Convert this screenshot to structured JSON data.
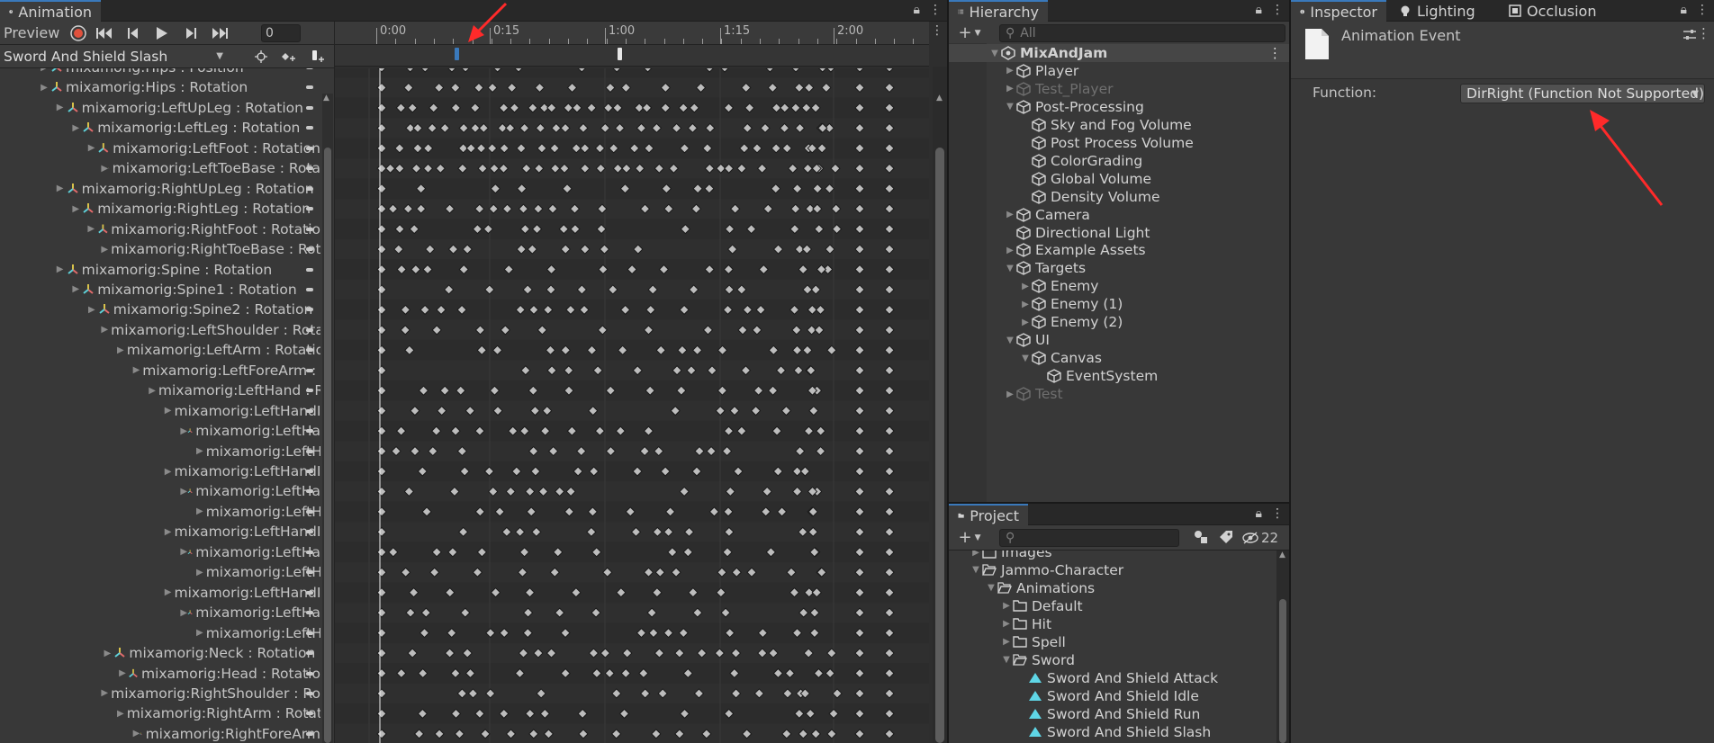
{
  "animation": {
    "tab_title": "Animation",
    "preview_label": "Preview",
    "frame_value": "0",
    "clip_name": "Sword And Shield Slash",
    "ruler_labels": [
      "0:00",
      "0:15",
      "1:00",
      "1:15",
      "2:00"
    ],
    "properties": [
      {
        "label": "mixamorig:Hips : Position",
        "indent": 0,
        "expanded": false
      },
      {
        "label": "mixamorig:Hips : Rotation",
        "indent": 0,
        "expanded": false
      },
      {
        "label": "mixamorig:LeftUpLeg : Rotation",
        "indent": 1,
        "expanded": false
      },
      {
        "label": "mixamorig:LeftLeg : Rotation",
        "indent": 2,
        "expanded": false
      },
      {
        "label": "mixamorig:LeftFoot : Rotation",
        "indent": 3,
        "expanded": false
      },
      {
        "label": "mixamorig:LeftToeBase : Rota",
        "indent": 4,
        "expanded": false
      },
      {
        "label": "mixamorig:RightUpLeg : Rotation",
        "indent": 1,
        "expanded": false
      },
      {
        "label": "mixamorig:RightLeg : Rotation",
        "indent": 2,
        "expanded": false
      },
      {
        "label": "mixamorig:RightFoot : Rotatio",
        "indent": 3,
        "expanded": false
      },
      {
        "label": "mixamorig:RightToeBase : Rot",
        "indent": 4,
        "expanded": false
      },
      {
        "label": "mixamorig:Spine : Rotation",
        "indent": 1,
        "expanded": false
      },
      {
        "label": "mixamorig:Spine1 : Rotation",
        "indent": 2,
        "expanded": false
      },
      {
        "label": "mixamorig:Spine2 : Rotation",
        "indent": 3,
        "expanded": false
      },
      {
        "label": "mixamorig:LeftShoulder : Rota",
        "indent": 4,
        "expanded": false
      },
      {
        "label": "mixamorig:LeftArm : Rotatio",
        "indent": 5,
        "expanded": false
      },
      {
        "label": "mixamorig:LeftForeArm : R",
        "indent": 6,
        "expanded": false
      },
      {
        "label": "mixamorig:LeftHand : R",
        "indent": 7,
        "expanded": false
      },
      {
        "label": "mixamorig:LeftHandI",
        "indent": 8,
        "expanded": false
      },
      {
        "label": "mixamorig:LeftHa",
        "indent": 9,
        "expanded": false
      },
      {
        "label": "mixamorig:LeftH",
        "indent": 10,
        "expanded": false
      },
      {
        "label": "mixamorig:LeftHandI",
        "indent": 8,
        "expanded": false
      },
      {
        "label": "mixamorig:LeftHa",
        "indent": 9,
        "expanded": false
      },
      {
        "label": "mixamorig:LeftH",
        "indent": 10,
        "expanded": false
      },
      {
        "label": "mixamorig:LeftHandI",
        "indent": 8,
        "expanded": false
      },
      {
        "label": "mixamorig:LeftHa",
        "indent": 9,
        "expanded": false
      },
      {
        "label": "mixamorig:LeftH",
        "indent": 10,
        "expanded": false
      },
      {
        "label": "mixamorig:LeftHandI",
        "indent": 8,
        "expanded": false
      },
      {
        "label": "mixamorig:LeftHa",
        "indent": 9,
        "expanded": false
      },
      {
        "label": "mixamorig:LeftH",
        "indent": 10,
        "expanded": false
      },
      {
        "label": "mixamorig:Neck : Rotation",
        "indent": 4,
        "expanded": false
      },
      {
        "label": "mixamorig:Head : Rotatio",
        "indent": 5,
        "expanded": false
      },
      {
        "label": "mixamorig:RightShoulder : Rot",
        "indent": 4,
        "expanded": false
      },
      {
        "label": "mixamorig:RightArm : Rotati",
        "indent": 5,
        "expanded": false
      },
      {
        "label": "mixamorig:RightForeArm",
        "indent": 6,
        "expanded": false
      }
    ]
  },
  "hierarchy": {
    "tab_title": "Hierarchy",
    "search_placeholder": "All",
    "items": [
      {
        "label": "MixAndJam",
        "indent": 0,
        "arrow": "down",
        "kind": "scene",
        "dim": false,
        "selected": true
      },
      {
        "label": "Player",
        "indent": 1,
        "arrow": "right",
        "kind": "cube",
        "dim": false
      },
      {
        "label": "Test_Player",
        "indent": 1,
        "arrow": "right",
        "kind": "cube",
        "dim": true
      },
      {
        "label": "Post-Processing",
        "indent": 1,
        "arrow": "down",
        "kind": "cube",
        "dim": false
      },
      {
        "label": "Sky and Fog Volume",
        "indent": 2,
        "arrow": "",
        "kind": "cube",
        "dim": false
      },
      {
        "label": "Post Process Volume",
        "indent": 2,
        "arrow": "",
        "kind": "cube",
        "dim": false
      },
      {
        "label": "ColorGrading",
        "indent": 2,
        "arrow": "",
        "kind": "cube",
        "dim": false
      },
      {
        "label": "Global Volume",
        "indent": 2,
        "arrow": "",
        "kind": "cube",
        "dim": false
      },
      {
        "label": "Density Volume",
        "indent": 2,
        "arrow": "",
        "kind": "cube",
        "dim": false
      },
      {
        "label": "Camera",
        "indent": 1,
        "arrow": "right",
        "kind": "cube",
        "dim": false
      },
      {
        "label": "Directional Light",
        "indent": 1,
        "arrow": "",
        "kind": "cube",
        "dim": false
      },
      {
        "label": "Example Assets",
        "indent": 1,
        "arrow": "right",
        "kind": "cube",
        "dim": false
      },
      {
        "label": "Targets",
        "indent": 1,
        "arrow": "down",
        "kind": "cube",
        "dim": false
      },
      {
        "label": "Enemy",
        "indent": 2,
        "arrow": "right",
        "kind": "cube",
        "dim": false
      },
      {
        "label": "Enemy (1)",
        "indent": 2,
        "arrow": "right",
        "kind": "cube",
        "dim": false
      },
      {
        "label": "Enemy (2)",
        "indent": 2,
        "arrow": "right",
        "kind": "cube",
        "dim": false
      },
      {
        "label": "UI",
        "indent": 1,
        "arrow": "down",
        "kind": "cube",
        "dim": false
      },
      {
        "label": "Canvas",
        "indent": 2,
        "arrow": "down",
        "kind": "cube",
        "dim": false
      },
      {
        "label": "EventSystem",
        "indent": 3,
        "arrow": "",
        "kind": "cube",
        "dim": false
      },
      {
        "label": "Test",
        "indent": 1,
        "arrow": "right",
        "kind": "cube",
        "dim": true
      }
    ]
  },
  "project": {
    "tab_title": "Project",
    "hidden_count": "22",
    "items": [
      {
        "label": "Images",
        "indent": 1,
        "arrow": "right",
        "kind": "folder"
      },
      {
        "label": "Jammo-Character",
        "indent": 1,
        "arrow": "down",
        "kind": "folder-open"
      },
      {
        "label": "Animations",
        "indent": 2,
        "arrow": "down",
        "kind": "folder-open"
      },
      {
        "label": "Default",
        "indent": 3,
        "arrow": "right",
        "kind": "folder"
      },
      {
        "label": "Hit",
        "indent": 3,
        "arrow": "right",
        "kind": "folder"
      },
      {
        "label": "Spell",
        "indent": 3,
        "arrow": "right",
        "kind": "folder"
      },
      {
        "label": "Sword",
        "indent": 3,
        "arrow": "down",
        "kind": "folder-open"
      },
      {
        "label": "Sword And Shield Attack",
        "indent": 4,
        "arrow": "",
        "kind": "anim"
      },
      {
        "label": "Sword And Shield Idle",
        "indent": 4,
        "arrow": "",
        "kind": "anim"
      },
      {
        "label": "Sword And Shield Run",
        "indent": 4,
        "arrow": "",
        "kind": "anim"
      },
      {
        "label": "Sword And Shield Slash",
        "indent": 4,
        "arrow": "",
        "kind": "anim"
      }
    ]
  },
  "inspector": {
    "tabs": [
      "Inspector",
      "Lighting",
      "Occlusion"
    ],
    "component_title": "Animation Event",
    "function_label": "Function:",
    "function_value": "DirRight (Function Not Supported)"
  },
  "colors": {
    "accent_blue": "#3a79bb",
    "record_red": "#e0513d",
    "annotation_red": "#ff2a2a",
    "bone_pink": "#e26b6b",
    "bone_yellow": "#d8c24a",
    "bone_cyan": "#5fd1d8",
    "anim_clip": "#5fd6e6"
  }
}
